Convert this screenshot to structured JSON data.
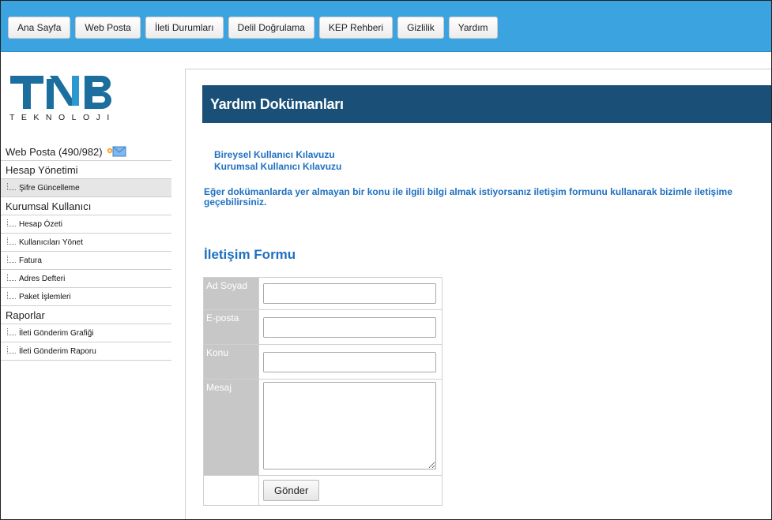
{
  "nav": {
    "items": [
      {
        "label": "Ana Sayfa"
      },
      {
        "label": "Web Posta"
      },
      {
        "label": "İleti Durumları"
      },
      {
        "label": "Delil Doğrulama"
      },
      {
        "label": "KEP Rehberi"
      },
      {
        "label": "Gizlilik"
      },
      {
        "label": "Yardım"
      }
    ]
  },
  "logo": {
    "main": "TNB",
    "sub": "TEKNOLOJI"
  },
  "sidebar": {
    "webposta": "Web Posta (490/982)",
    "sections": [
      {
        "title": "Hesap Yönetimi",
        "items": [
          "Şifre Güncelleme"
        ]
      },
      {
        "title": "Kurumsal Kullanıcı",
        "items": [
          "Hesap Özeti",
          "Kullanıcıları Yönet",
          "Fatura",
          "Adres Defteri",
          "Paket İşlemleri"
        ]
      },
      {
        "title": "Raporlar",
        "items": [
          "İleti Gönderim Grafiği",
          "İleti Gönderim Raporu"
        ]
      }
    ]
  },
  "main": {
    "title": "Yardım Dokümanları",
    "links": [
      "Bireysel Kullanıcı Kılavuzu",
      "Kurumsal Kullanıcı Kılavuzu"
    ],
    "info": "Eğer dokümanlarda yer almayan bir konu ile ilgili bilgi almak istiyorsanız iletişim formunu kullanarak bizimle iletişime geçebilirsiniz.",
    "form": {
      "title": "İletişim Formu",
      "name_label": "Ad Soyad",
      "email_label": "E-posta",
      "subject_label": "Konu",
      "message_label": "Mesaj",
      "submit": "Gönder",
      "name_value": "",
      "email_value": "",
      "subject_value": "",
      "message_value": ""
    }
  },
  "colors": {
    "topbar": "#3aa3e0",
    "header": "#1a5077",
    "link": "#1f70c1",
    "label_bg": "#c7c7c7"
  }
}
